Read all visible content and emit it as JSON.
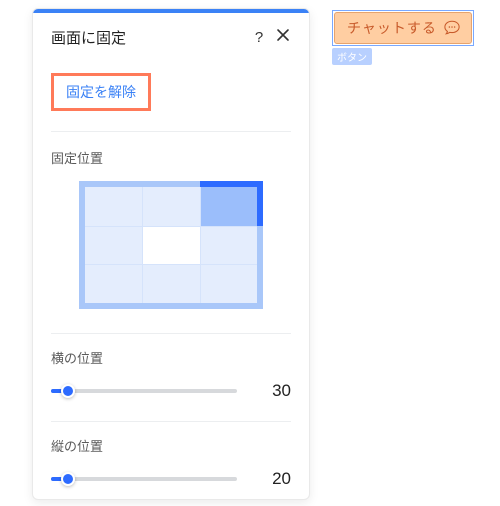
{
  "panel": {
    "title": "画面に固定",
    "help_label": "?",
    "unpin_label": "固定を解除",
    "position_section_label": "固定位置",
    "position": {
      "row": 0,
      "col": 2
    },
    "horizontal_label": "横の位置",
    "horizontal_value": 30,
    "vertical_label": "縦の位置",
    "vertical_value": 20
  },
  "canvas": {
    "chat_button_label": "チャットする",
    "selection_tag": "ボタン"
  },
  "colors": {
    "accent": "#2d6bff",
    "highlight_border": "#ff7a59",
    "chat_bg": "#ffcea2",
    "chat_fg": "#c85a2a"
  }
}
